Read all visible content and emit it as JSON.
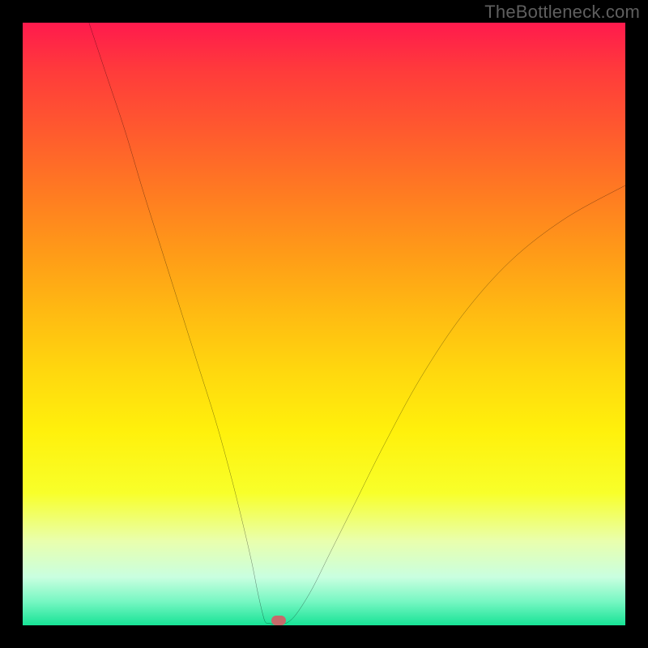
{
  "watermark": "TheBottleneck.com",
  "chart_data": {
    "type": "line",
    "title": "",
    "xlabel": "",
    "ylabel": "",
    "xlim": [
      0,
      100
    ],
    "ylim": [
      0,
      100
    ],
    "grid": false,
    "legend": false,
    "background_gradient": {
      "top": "#ff1a4d",
      "bottom": "#17e396",
      "stops": [
        {
          "pct": 0,
          "color": "#ff1a4d"
        },
        {
          "pct": 18,
          "color": "#ff5a2e"
        },
        {
          "pct": 38,
          "color": "#ff9a18"
        },
        {
          "pct": 58,
          "color": "#ffd80e"
        },
        {
          "pct": 78,
          "color": "#f8ff2a"
        },
        {
          "pct": 92,
          "color": "#c9ffe0"
        },
        {
          "pct": 100,
          "color": "#17e396"
        }
      ]
    },
    "series": [
      {
        "name": "left-branch",
        "x": [
          11,
          14,
          17,
          20,
          23,
          26,
          29,
          32,
          34.5,
          36.5,
          38,
          39,
          39.8,
          40.3
        ],
        "y": [
          100,
          91,
          82,
          72,
          62.5,
          53,
          43.5,
          34,
          25,
          17,
          10.5,
          5.5,
          2,
          0.5
        ]
      },
      {
        "name": "valley-floor",
        "x": [
          40.3,
          41.0,
          42.0,
          43.0,
          44.0
        ],
        "y": [
          0.5,
          0.3,
          0.2,
          0.3,
          0.5
        ]
      },
      {
        "name": "right-branch",
        "x": [
          44.0,
          45.5,
          48,
          51,
          55,
          60,
          66,
          73,
          81,
          90,
          100
        ],
        "y": [
          0.5,
          2,
          6,
          12,
          20,
          30,
          41,
          51.5,
          60.5,
          67.5,
          73
        ]
      }
    ],
    "marker": {
      "x": 42.5,
      "y": 0.8,
      "color": "#c66a6a"
    }
  }
}
